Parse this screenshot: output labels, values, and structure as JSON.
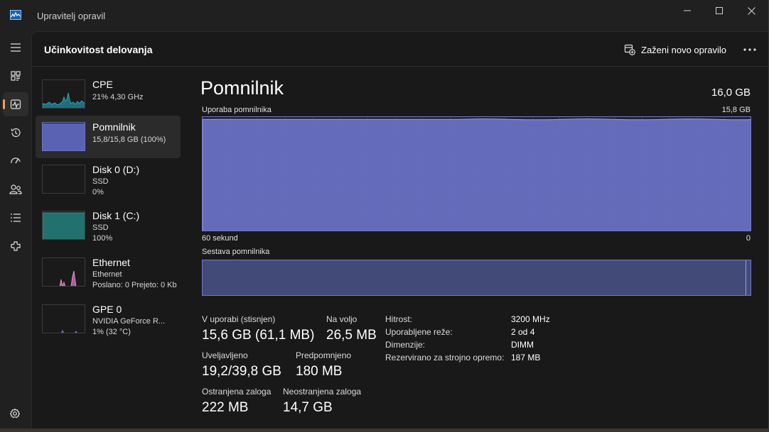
{
  "window": {
    "title": "Upravitelj opravil"
  },
  "colors": {
    "accent": "#f0a060",
    "memory": "#6d75c8",
    "disk": "#2d8f8a",
    "cpu": "#2aa6b8",
    "ethernet": "#e58dc8",
    "gpu": "#8c6fd0"
  },
  "rail": {
    "items": [
      {
        "icon": "hamburger-menu-icon"
      },
      {
        "icon": "processes-icon"
      },
      {
        "icon": "performance-icon",
        "active": true
      },
      {
        "icon": "app-history-icon"
      },
      {
        "icon": "startup-apps-icon"
      },
      {
        "icon": "users-icon"
      },
      {
        "icon": "details-icon"
      },
      {
        "icon": "services-icon"
      }
    ],
    "settings_icon": "settings-gear-icon"
  },
  "header": {
    "title": "Učinkovitost delovanja",
    "run_task_label": "Zaženi novo opravilo",
    "more_icon": "more-options-icon"
  },
  "perf_items": [
    {
      "name": "CPE",
      "line1": "21% 4,30 GHz",
      "line2": ""
    },
    {
      "name": "Pomnilnik",
      "line1": "15,8/15,8 GB (100%)",
      "line2": ""
    },
    {
      "name": "Disk 0 (D:)",
      "line1": "SSD",
      "line2": "0%"
    },
    {
      "name": "Disk 1 (C:)",
      "line1": "SSD",
      "line2": "100%"
    },
    {
      "name": "Ethernet",
      "line1": "Ethernet",
      "line2": "Poslano: 0 Prejeto: 0 Kb"
    },
    {
      "name": "GPE 0",
      "line1": "NVIDIA GeForce R...",
      "line2": "1% (32 °C)"
    }
  ],
  "detail": {
    "title": "Pomnilnik",
    "total": "16,0 GB",
    "usage_label": "Uporaba pomnilnika",
    "usage_max": "15,8 GB",
    "axis_left": "60 sekund",
    "axis_right": "0",
    "composition_label": "Sestava pomnilnika",
    "usage_fraction": 0.98
  },
  "stats": {
    "in_use_label": "V uporabi (stisnjen)",
    "in_use_value": "15,6 GB (61,1 MB)",
    "available_label": "Na voljo",
    "available_value": "26,5 MB",
    "committed_label": "Uveljavljeno",
    "committed_value": "19,2/39,8 GB",
    "cached_label": "Predpomnjeno",
    "cached_value": "180 MB",
    "paged_label": "Ostranjena zaloga",
    "paged_value": "222 MB",
    "nonpaged_label": "Neostranjena zaloga",
    "nonpaged_value": "14,7 GB"
  },
  "specs": [
    {
      "label": "Hitrost:",
      "value": "3200 MHz"
    },
    {
      "label": "Uporabljene reže:",
      "value": "2 od 4"
    },
    {
      "label": "Dimenzije:",
      "value": "DIMM"
    },
    {
      "label": "Rezervirano za strojno opremo:",
      "value": "187 MB"
    }
  ]
}
